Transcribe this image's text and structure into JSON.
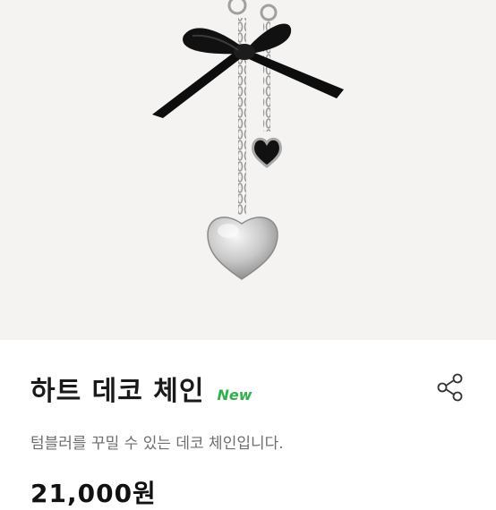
{
  "product": {
    "name": "하트 데코 체인",
    "badge": "New",
    "description": "텀블러를 꾸밀 수 있는 데코 체인입니다.",
    "price": "21,000원"
  },
  "icons": {
    "share": "share-icon"
  },
  "colors": {
    "badge": "#2fb24c",
    "title": "#1a1a1a",
    "description": "#6e6e6e",
    "image_background": "#f4f3f1"
  }
}
